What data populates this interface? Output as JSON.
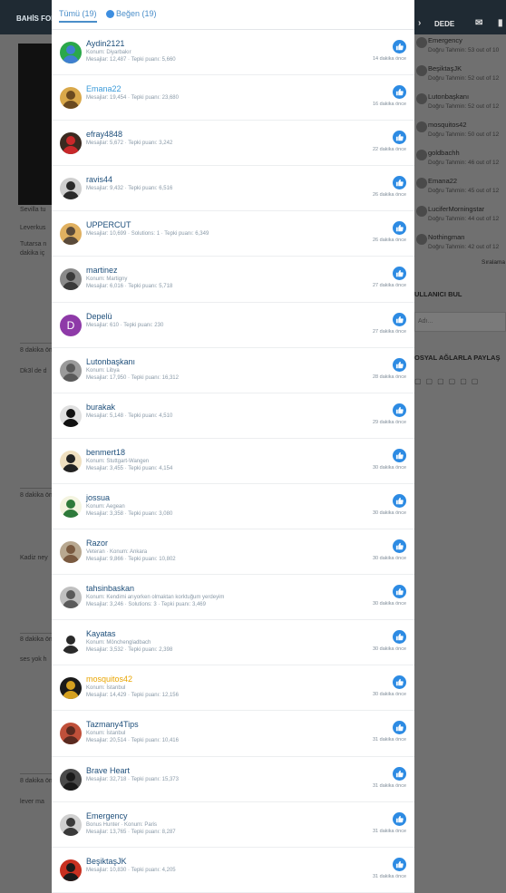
{
  "background": {
    "brand": "BAHİS FORU",
    "user_label": "DEDE",
    "left_texts": [
      "Sevilla tu",
      "Leverkus",
      "Tutarsa n",
      "dakika iç",
      "Dk3l de d",
      "Kadiz ney",
      "ses yok h",
      "lever ma"
    ],
    "left_meta": [
      "8 dakika ön",
      "8 dakika ön",
      "8 dakika ön",
      "8 dakika ön"
    ],
    "sidebar": [
      {
        "name": "Emergency",
        "sub": "Doğru Tahmin: 53 out of 10"
      },
      {
        "name": "BeşiktaşJK",
        "sub": "Doğru Tahmin: 52 out of 12"
      },
      {
        "name": "Lutonbaşkanı",
        "sub": "Doğru Tahmin: 52 out of 12"
      },
      {
        "name": "mosquitos42",
        "sub": "Doğru Tahmin: 50 out of 12"
      },
      {
        "name": "goldbachh",
        "sub": "Doğru Tahmin: 46 out of 12"
      },
      {
        "name": "Emana22",
        "sub": "Doğru Tahmin: 45 out of 12"
      },
      {
        "name": "LuciferMorningstar",
        "sub": "Doğru Tahmin: 44 out of 12"
      },
      {
        "name": "Nothingman",
        "sub": "Doğru Tahmin: 42 out of 12"
      }
    ],
    "siralama": "Sıralama",
    "find_user": "ULLANICI BUL",
    "name_placeholder": "Adı...",
    "social_share": "OSYAL AĞLARLA PAYLAŞ"
  },
  "tabs": {
    "all": "Tümü (19)",
    "like": "Beğen (19)"
  },
  "reactions": [
    {
      "name": "Aydin2121",
      "line1": "Konum: Diyarbakır",
      "line2": "Mesajlar: 12,487 · Tepki puanı: 5,660",
      "time": "14 dakika önce",
      "color": "#1d4e7a",
      "av": "#2aa84a",
      "av2": "#3f7fd0"
    },
    {
      "name": "Emana22",
      "line1": "",
      "line2": "Mesajlar: 19,454 · Tepki puanı: 23,680",
      "time": "16 dakika önce",
      "color": "#3a9ad9",
      "av": "#d9a84a",
      "av2": "#6b4a1f"
    },
    {
      "name": "efray4848",
      "line1": "",
      "line2": "Mesajlar: 5,672 · Tepki puanı: 3,242",
      "time": "22 dakika önce",
      "color": "#1d4e7a",
      "av": "#3a2a20",
      "av2": "#c8282a"
    },
    {
      "name": "ravis44",
      "line1": "",
      "line2": "Mesajlar: 9,432 · Tepki puanı: 6,516",
      "time": "26 dakika önce",
      "color": "#1d4e7a",
      "av": "#cfcfcf",
      "av2": "#2a2a2a"
    },
    {
      "name": "UPPERCUT",
      "line1": "",
      "line2": "Mesajlar: 10,699 · Solutions: 1 · Tepki puanı: 6,349",
      "time": "26 dakika önce",
      "color": "#1d4e7a",
      "av": "#e0b060",
      "av2": "#5a4a3a"
    },
    {
      "name": "martinez",
      "line1": "Konum: Martigny",
      "line2": "Mesajlar: 6,016 · Tepki puanı: 5,718",
      "time": "27 dakika önce",
      "color": "#1d4e7a",
      "av": "#8a8a8a",
      "av2": "#3a3a3a"
    },
    {
      "name": "Depelü",
      "line1": "",
      "line2": "Mesajlar: 610 · Tepki puanı: 230",
      "time": "27 dakika önce",
      "color": "#1d4e7a",
      "av": "#8e3aa8",
      "av2": "#8e3aa8",
      "letter": "D"
    },
    {
      "name": "Lutonbaşkanı",
      "line1": "Konum: Libya",
      "line2": "Mesajlar: 17,950 · Tepki puanı: 16,312",
      "time": "28 dakika önce",
      "color": "#1d4e7a",
      "av": "#9a9a9a",
      "av2": "#5a5a5a"
    },
    {
      "name": "burakak",
      "line1": "",
      "line2": "Mesajlar: 5,148 · Tepki puanı: 4,510",
      "time": "29 dakika önce",
      "color": "#1d4e7a",
      "av": "#e0e0e0",
      "av2": "#111111"
    },
    {
      "name": "benmert18",
      "line1": "Konum: Stuttgart-Wangen",
      "line2": "Mesajlar: 3,455 · Tepki puanı: 4,154",
      "time": "30 dakika önce",
      "color": "#1d4e7a",
      "av": "#f0e0c0",
      "av2": "#222222"
    },
    {
      "name": "jossua",
      "line1": "Konum: Aegean",
      "line2": "Mesajlar: 3,358 · Tepki puanı: 3,080",
      "time": "30 dakika önce",
      "color": "#1d4e7a",
      "av": "#f4f4e0",
      "av2": "#2e7a3a"
    },
    {
      "name": "Razor",
      "line1": "Veteran · Konum: Ankara",
      "line2": "Mesajlar: 9,866 · Tepki puanı: 10,802",
      "time": "30 dakika önce",
      "color": "#1d4e7a",
      "av": "#b8a890",
      "av2": "#7a5a40"
    },
    {
      "name": "tahsinbaskan",
      "line1": "Konum: Kendimi arıyorken olmaktan korktuğum yerdeyim",
      "line2": "Mesajlar: 3,246 · Solutions: 3 · Tepki puanı: 3,469",
      "time": "30 dakika önce",
      "color": "#1d4e7a",
      "av": "#c0c0c0",
      "av2": "#5a5a5a"
    },
    {
      "name": "Kayatas",
      "line1": "Konum: Mönchengladbach",
      "line2": "Mesajlar: 3,532 · Tepki puanı: 2,398",
      "time": "30 dakika önce",
      "color": "#1d4e7a",
      "av": "#ffffff",
      "av2": "#2a2a2a"
    },
    {
      "name": "mosquitos42",
      "line1": "Konum: İstanbul",
      "line2": "Mesajlar: 14,429 · Tepki puanı: 12,156",
      "time": "30 dakika önce",
      "color": "#e8a400",
      "av": "#1a1a1a",
      "av2": "#d4a020"
    },
    {
      "name": "Tazmany4Tips",
      "line1": "Konum: İstanbul",
      "line2": "Mesajlar: 20,514 · Tepki puanı: 10,416",
      "time": "31 dakika önce",
      "color": "#1d4e7a",
      "av": "#c0503a",
      "av2": "#5a2a20"
    },
    {
      "name": "Brave Heart",
      "line1": "",
      "line2": "Mesajlar: 32,718 · Tepki puanı: 15,373",
      "time": "31 dakika önce",
      "color": "#1d4e7a",
      "av": "#4a4a4a",
      "av2": "#1a1a1a"
    },
    {
      "name": "Emergency",
      "line1": "Bonus Hunter · Konum: Paris",
      "line2": "Mesajlar: 13,765 · Tepki puanı: 8,287",
      "time": "31 dakika önce",
      "color": "#1d4e7a",
      "av": "#d0d0d0",
      "av2": "#3a3a3a"
    },
    {
      "name": "BeşiktaşJK",
      "line1": "",
      "line2": "Mesajlar: 10,830 · Tepki puanı: 4,205",
      "time": "31 dakika önce",
      "color": "#1d4e7a",
      "av": "#c83020",
      "av2": "#1a1a1a"
    }
  ]
}
